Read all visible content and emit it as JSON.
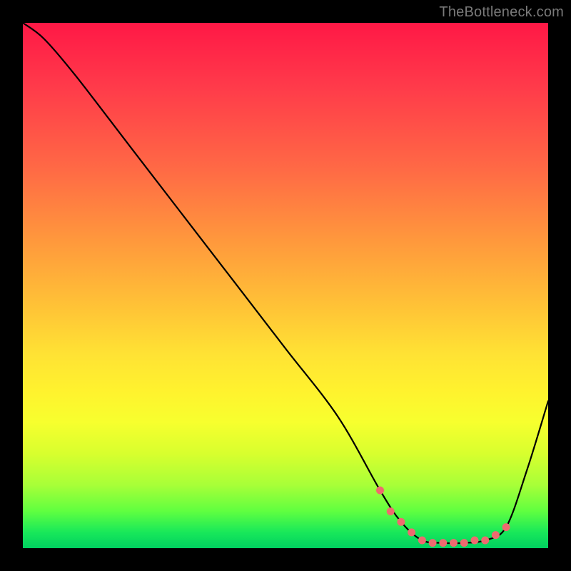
{
  "attribution": "TheBottleneck.com",
  "colors": {
    "frame": "#000000",
    "curve": "#000000",
    "marker": "#ef6a6f",
    "gradient_stops": [
      "#ff1846",
      "#ff6a45",
      "#ffc636",
      "#fff22e",
      "#a8ff38",
      "#00d060"
    ]
  },
  "chart_data": {
    "type": "line",
    "title": "",
    "xlabel": "",
    "ylabel": "",
    "xlim": [
      0,
      100
    ],
    "ylim": [
      0,
      100
    ],
    "series": [
      {
        "name": "bottleneck-curve",
        "x": [
          0,
          4,
          10,
          20,
          30,
          40,
          50,
          60,
          68,
          72,
          76,
          80,
          84,
          88,
          92,
          96,
          100
        ],
        "y": [
          100,
          97,
          90,
          77,
          64,
          51,
          38,
          25,
          11,
          5,
          1.5,
          1,
          1,
          1.5,
          4,
          15,
          28
        ]
      }
    ],
    "markers": {
      "name": "highlight-dots",
      "x": [
        68,
        70,
        72,
        74,
        76,
        78,
        80,
        82,
        84,
        86,
        88,
        90,
        92
      ],
      "y": [
        11,
        7,
        5,
        3,
        1.5,
        1,
        1,
        1,
        1,
        1.5,
        1.5,
        2.5,
        4
      ]
    }
  }
}
